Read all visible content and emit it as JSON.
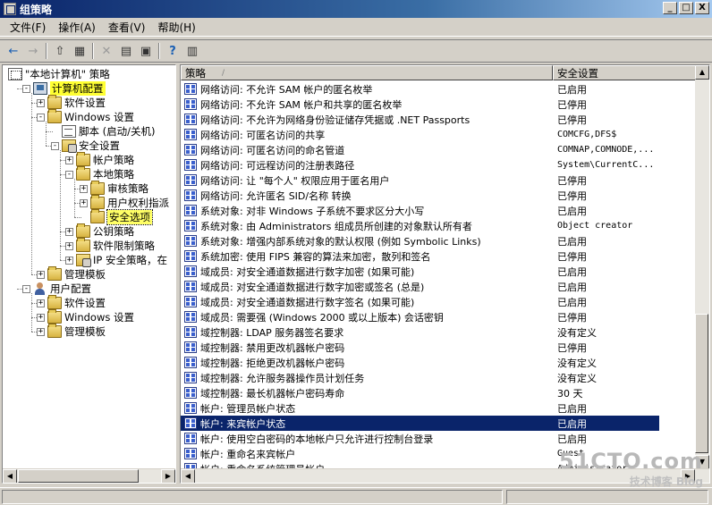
{
  "window": {
    "title": "组策略",
    "minimize": "_",
    "maximize": "□",
    "close": "X"
  },
  "menu": [
    "文件(F)",
    "操作(A)",
    "查看(V)",
    "帮助(H)"
  ],
  "toolbar": {
    "back": "←",
    "forward": "→",
    "up": "⇧",
    "show_tree": "▦",
    "delete": "✕",
    "properties": "▤",
    "export": "▣",
    "help": "?",
    "console": "▥"
  },
  "tree": [
    {
      "label": "\"本地计算机\" 策略",
      "icon": "policy-root-icon",
      "level": 0,
      "exp": ""
    },
    {
      "label": "计算机配置",
      "icon": "computer-icon",
      "level": 1,
      "exp": "-",
      "highlight": true
    },
    {
      "label": "软件设置",
      "icon": "folder-icon",
      "level": 2,
      "exp": "+"
    },
    {
      "label": "Windows 设置",
      "icon": "folder-icon",
      "level": 2,
      "exp": "-"
    },
    {
      "label": "脚本 (启动/关机)",
      "icon": "doc-icon",
      "level": 3,
      "exp": ""
    },
    {
      "label": "安全设置",
      "icon": "shield-icon",
      "level": 3,
      "exp": "-"
    },
    {
      "label": "帐户策略",
      "icon": "folder-icon",
      "level": 4,
      "exp": "+"
    },
    {
      "label": "本地策略",
      "icon": "folder-icon",
      "level": 4,
      "exp": "-"
    },
    {
      "label": "审核策略",
      "icon": "folder-icon",
      "level": 5,
      "exp": "+"
    },
    {
      "label": "用户权利指派",
      "icon": "folder-icon",
      "level": 5,
      "exp": "+"
    },
    {
      "label": "安全选项",
      "icon": "folder-icon",
      "level": 5,
      "exp": "",
      "selected": true
    },
    {
      "label": "公钥策略",
      "icon": "folder-icon",
      "level": 4,
      "exp": "+"
    },
    {
      "label": "软件限制策略",
      "icon": "folder-icon",
      "level": 4,
      "exp": "+"
    },
    {
      "label": "IP 安全策略，在",
      "icon": "shield-icon",
      "level": 4,
      "exp": "+"
    },
    {
      "label": "管理模板",
      "icon": "folder-icon",
      "level": 2,
      "exp": "+"
    },
    {
      "label": "用户配置",
      "icon": "user-icon",
      "level": 1,
      "exp": "-"
    },
    {
      "label": "软件设置",
      "icon": "folder-icon",
      "level": 2,
      "exp": "+"
    },
    {
      "label": "Windows 设置",
      "icon": "folder-icon",
      "level": 2,
      "exp": "+"
    },
    {
      "label": "管理模板",
      "icon": "folder-icon",
      "level": 2,
      "exp": "+"
    }
  ],
  "list": {
    "headers": {
      "policy": "策略",
      "sort_indicator": "/",
      "setting": "安全设置"
    },
    "rows": [
      {
        "name": "网络访问: 不允许 SAM 帐户的匿名枚举",
        "setting": "已启用"
      },
      {
        "name": "网络访问: 不允许 SAM 帐户和共享的匿名枚举",
        "setting": "已停用"
      },
      {
        "name": "网络访问: 不允许为网络身份验证储存凭据或 .NET Passports",
        "setting": "已停用"
      },
      {
        "name": "网络访问: 可匿名访问的共享",
        "setting": "COMCFG,DFS$",
        "mono": true
      },
      {
        "name": "网络访问: 可匿名访问的命名管道",
        "setting": "COMNAP,COMNODE,...",
        "mono": true
      },
      {
        "name": "网络访问: 可远程访问的注册表路径",
        "setting": "System\\CurrentC...",
        "mono": true
      },
      {
        "name": "网络访问: 让 \"每个人\" 权限应用于匿名用户",
        "setting": "已停用"
      },
      {
        "name": "网络访问: 允许匿名 SID/名称 转换",
        "setting": "已停用"
      },
      {
        "name": "系统对象: 对非 Windows 子系统不要求区分大小写",
        "setting": "已启用"
      },
      {
        "name": "系统对象: 由 Administrators 组成员所创建的对象默认所有者",
        "setting": "Object creator",
        "mono": true
      },
      {
        "name": "系统对象: 增强内部系统对象的默认权限 (例如 Symbolic Links)",
        "setting": "已启用"
      },
      {
        "name": "系统加密: 使用 FIPS 兼容的算法来加密，散列和签名",
        "setting": "已停用"
      },
      {
        "name": "域成员: 对安全通道数据进行数字加密 (如果可能)",
        "setting": "已启用"
      },
      {
        "name": "域成员: 对安全通道数据进行数字加密或签名 (总是)",
        "setting": "已启用"
      },
      {
        "name": "域成员: 对安全通道数据进行数字签名 (如果可能)",
        "setting": "已启用"
      },
      {
        "name": "域成员: 需要强 (Windows 2000 或以上版本) 会话密钥",
        "setting": "已停用"
      },
      {
        "name": "域控制器: LDAP 服务器签名要求",
        "setting": "没有定义"
      },
      {
        "name": "域控制器: 禁用更改机器帐户密码",
        "setting": "已停用"
      },
      {
        "name": "域控制器: 拒绝更改机器帐户密码",
        "setting": "没有定义"
      },
      {
        "name": "域控制器: 允许服务器操作员计划任务",
        "setting": "没有定义"
      },
      {
        "name": "域控制器: 最长机器帐户密码寿命",
        "setting": "30 天"
      },
      {
        "name": "帐户: 管理员帐户状态",
        "setting": "已启用"
      },
      {
        "name": "帐户: 来宾帐户状态",
        "setting": "已启用",
        "selected": true
      },
      {
        "name": "帐户: 使用空白密码的本地帐户只允许进行控制台登录",
        "setting": "已启用"
      },
      {
        "name": "帐户: 重命名来宾帐户",
        "setting": "Guest",
        "mono": true
      },
      {
        "name": "帐户: 重命名系统管理员帐户",
        "setting": "Administrator",
        "mono": true
      }
    ]
  },
  "watermark": {
    "main": "51CTO.com",
    "sub": "技术博客  Blog"
  },
  "colors": {
    "selection": "#0a246a",
    "highlight": "#ffff33"
  }
}
